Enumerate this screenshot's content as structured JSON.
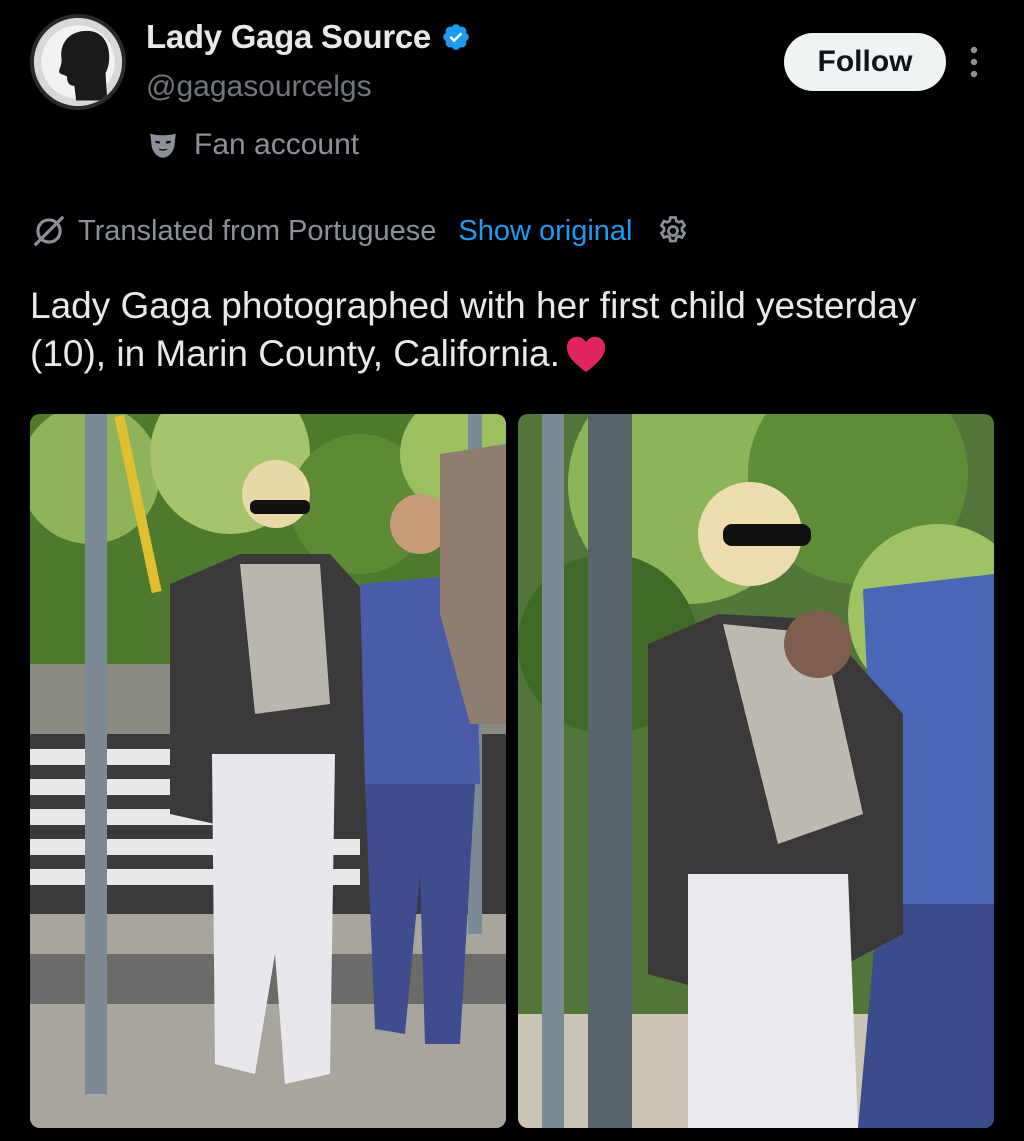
{
  "account": {
    "display_name": "Lady Gaga Source",
    "handle": "@gagasourcelgs",
    "label": "Fan account",
    "verified_color": "#1d9bf0",
    "avatar_icon": "woman-silhouette-avatar"
  },
  "actions": {
    "follow_label": "Follow",
    "more_icon": "more-vertical-icon"
  },
  "translation": {
    "notice": "Translated from Portuguese",
    "show_original": "Show original",
    "settings_icon": "gear-icon"
  },
  "tweet": {
    "text": "Lady Gaga photographed with her first child yesterday (10), in Marin County, California.",
    "emoji": "red-heart"
  },
  "media": [
    {
      "name": "photo-1",
      "icon": "paparazzi-photo"
    },
    {
      "name": "photo-2",
      "icon": "paparazzi-photo"
    }
  ],
  "colors": {
    "background": "#000000",
    "text_primary": "#e7e9ea",
    "text_secondary": "#71767b",
    "link": "#1d9bf0",
    "follow_bg": "#eff3f4"
  }
}
